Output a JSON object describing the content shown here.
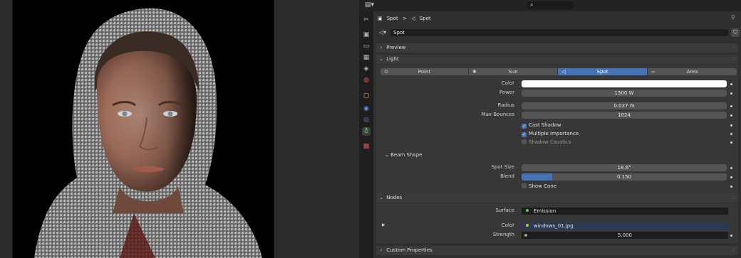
{
  "search": {
    "placeholder": ""
  },
  "breadcrumb": {
    "object": "Spot",
    "separator": ">",
    "data": "Spot"
  },
  "datablock": {
    "name": "Spot"
  },
  "panels": {
    "preview": "Preview",
    "light": "Light",
    "nodes": "Nodes",
    "custom_properties": "Custom Properties"
  },
  "light_types": [
    {
      "label": "Point",
      "icon": "point-light-icon",
      "active": false
    },
    {
      "label": "Sun",
      "icon": "sun-light-icon",
      "active": false
    },
    {
      "label": "Spot",
      "icon": "spot-light-icon",
      "active": true
    },
    {
      "label": "Area",
      "icon": "area-light-icon",
      "active": false
    }
  ],
  "light": {
    "color_label": "Color",
    "color_value": "#ffffff",
    "power_label": "Power",
    "power_value": "1500 W",
    "radius_label": "Radius",
    "radius_value": "0.027 m",
    "max_bounces_label": "Max Bounces",
    "max_bounces_value": "1024",
    "cast_shadow": "Cast Shadow",
    "multiple_importance": "Multiple Importance",
    "shadow_caustics": "Shadow Caustics"
  },
  "beam_shape": {
    "title": "Beam Shape",
    "spot_size_label": "Spot Size",
    "spot_size_value": "18.6°",
    "blend_label": "Blend",
    "blend_value": "0.150",
    "blend_fraction": 0.15,
    "show_cone": "Show Cone"
  },
  "nodes": {
    "surface_label": "Surface",
    "surface_value": "Emission",
    "color_label": "Color",
    "color_value": "windows_01.jpg",
    "strength_label": "Strength",
    "strength_value": "5.000"
  },
  "colors": {
    "accent": "#4772b3",
    "active_tab": "#7fd37f"
  }
}
